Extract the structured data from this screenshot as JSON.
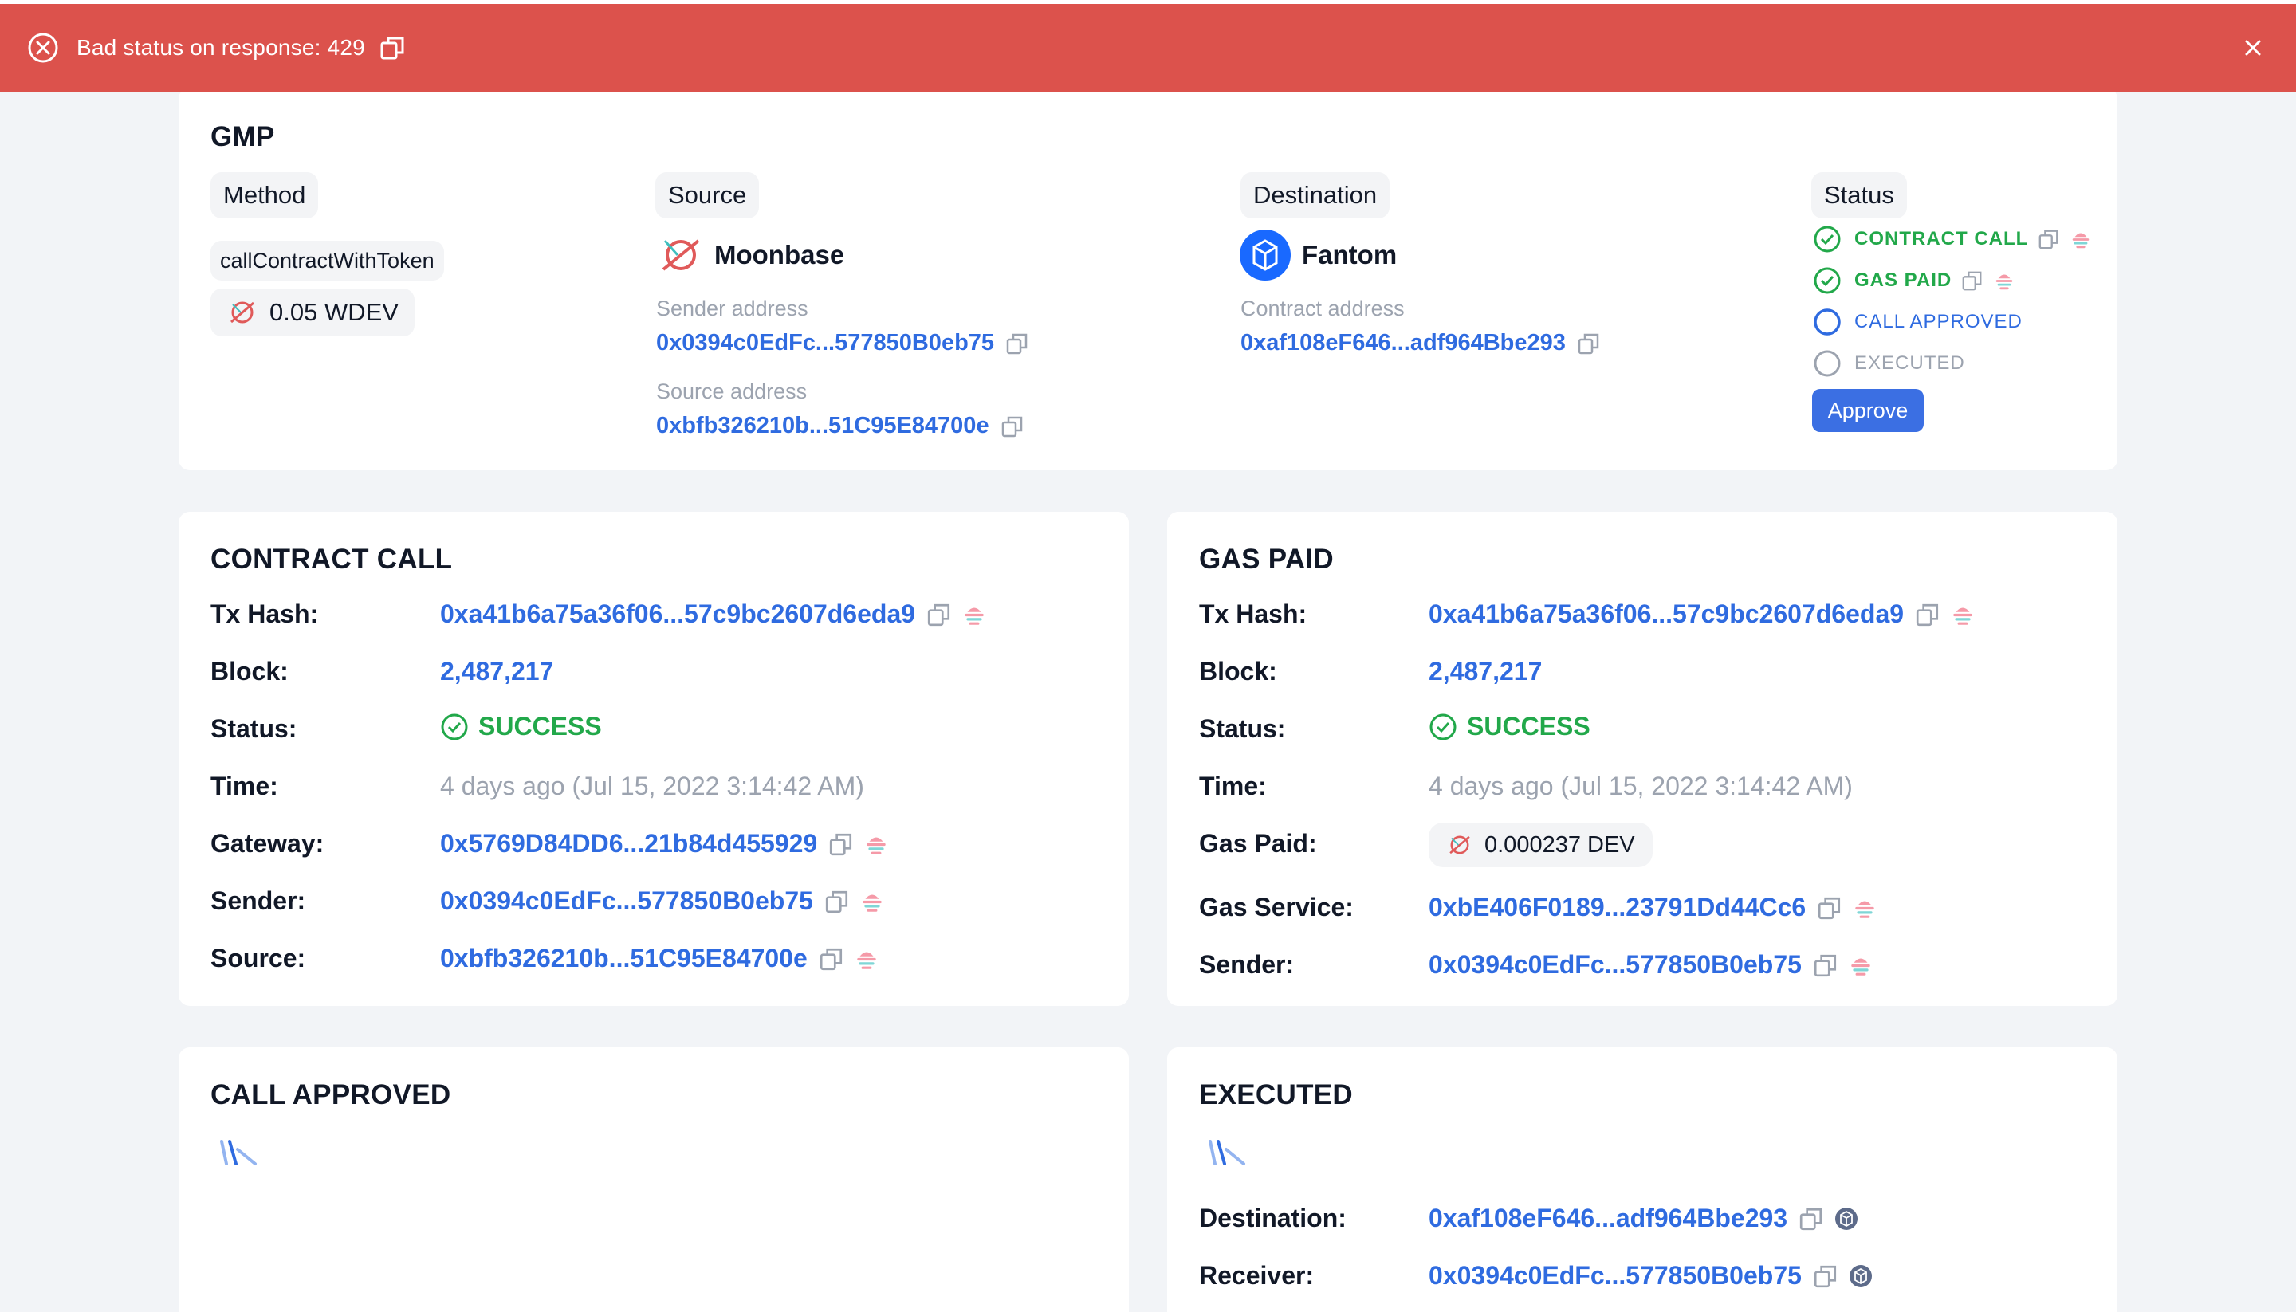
{
  "banner": {
    "message": "Bad status on response: 429"
  },
  "gmp": {
    "title": "GMP",
    "method": {
      "header": "Method",
      "name": "callContractWithToken",
      "amount": "0.05 WDEV"
    },
    "source": {
      "header": "Source",
      "chain": "Moonbase",
      "sender_label": "Sender address",
      "sender": "0x0394c0EdFc...577850B0eb75",
      "source_label": "Source address",
      "source": "0xbfb326210b...51C95E84700e"
    },
    "destination": {
      "header": "Destination",
      "chain": "Fantom",
      "contract_label": "Contract address",
      "contract": "0xaf108eF646...adf964Bbe293"
    },
    "status": {
      "header": "Status",
      "steps": [
        {
          "label": "CONTRACT CALL",
          "state": "done"
        },
        {
          "label": "GAS PAID",
          "state": "done"
        },
        {
          "label": "CALL APPROVED",
          "state": "pending"
        },
        {
          "label": "EXECUTED",
          "state": "todo"
        }
      ],
      "approve_label": "Approve"
    }
  },
  "contract_call": {
    "title": "CONTRACT CALL",
    "labels": {
      "tx": "Tx Hash:",
      "block": "Block:",
      "status": "Status:",
      "time": "Time:",
      "gateway": "Gateway:",
      "sender": "Sender:",
      "source": "Source:"
    },
    "tx": "0xa41b6a75a36f06...57c9bc2607d6eda9",
    "block": "2,487,217",
    "status": "SUCCESS",
    "time": "4 days ago (Jul 15, 2022 3:14:42 AM)",
    "gateway": "0x5769D84DD6...21b84d455929",
    "sender": "0x0394c0EdFc...577850B0eb75",
    "source": "0xbfb326210b...51C95E84700e"
  },
  "gas_paid": {
    "title": "GAS PAID",
    "labels": {
      "tx": "Tx Hash:",
      "block": "Block:",
      "status": "Status:",
      "time": "Time:",
      "gas_paid": "Gas Paid:",
      "gas_service": "Gas Service:",
      "sender": "Sender:"
    },
    "tx": "0xa41b6a75a36f06...57c9bc2607d6eda9",
    "block": "2,487,217",
    "status": "SUCCESS",
    "time": "4 days ago (Jul 15, 2022 3:14:42 AM)",
    "gas_amount": "0.000237 DEV",
    "gas_service": "0xbE406F0189...23791Dd44Cc6",
    "sender": "0x0394c0EdFc...577850B0eb75"
  },
  "call_approved": {
    "title": "CALL APPROVED"
  },
  "executed": {
    "title": "EXECUTED",
    "labels": {
      "destination": "Destination:",
      "receiver": "Receiver:"
    },
    "destination": "0xaf108eF646...adf964Bbe293",
    "receiver": "0x0394c0EdFc...577850B0eb75"
  },
  "colors": {
    "banner": "#dc524c",
    "link": "#2f6be0",
    "success": "#22a84a",
    "approve": "#3b6fe3"
  }
}
